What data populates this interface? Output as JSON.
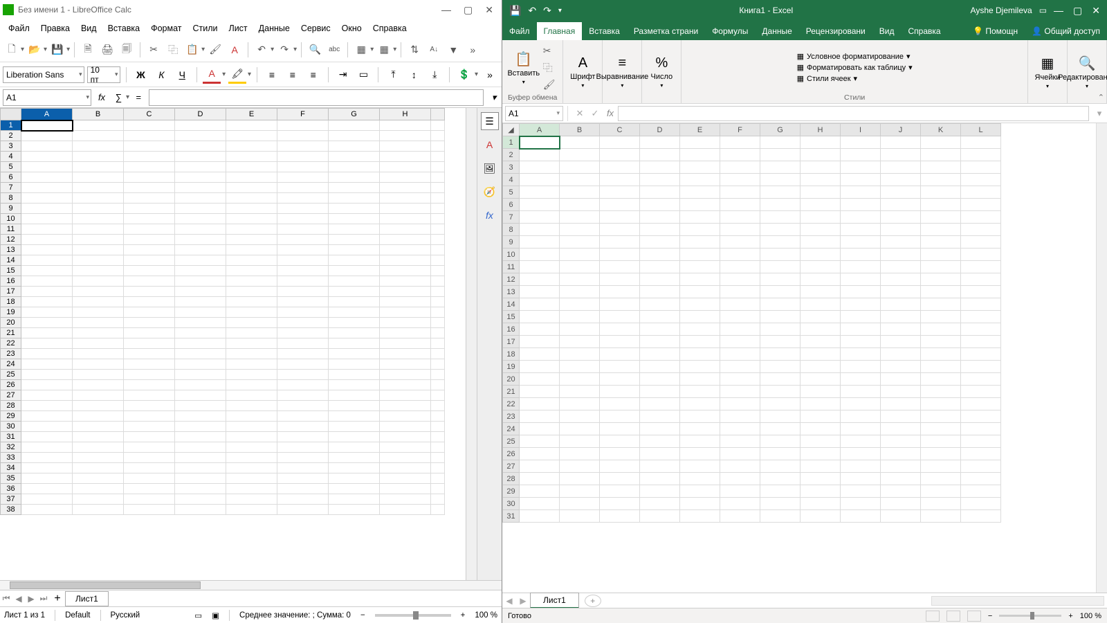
{
  "lo": {
    "title": "Без имени 1 - LibreOffice Calc",
    "menu": [
      "Файл",
      "Правка",
      "Вид",
      "Вставка",
      "Формат",
      "Стили",
      "Лист",
      "Данные",
      "Сервис",
      "Окно",
      "Справка"
    ],
    "fontName": "Liberation Sans",
    "fontSize": "10 пт",
    "cellRef": "A1",
    "tabName": "Лист1",
    "cols": [
      "A",
      "B",
      "C",
      "D",
      "E",
      "F",
      "G",
      "H"
    ],
    "rows": 38,
    "activeCell": "A1",
    "status": {
      "sheet": "Лист 1 из 1",
      "style": "Default",
      "lang": "Русский",
      "calc": "Среднее значение: ;  Сумма: 0",
      "zoom": "100 %"
    }
  },
  "xl": {
    "docTitle": "Книга1  -  Excel",
    "user": "Ayshe Djemileva",
    "ribbonTabs": [
      "Файл",
      "Главная",
      "Вставка",
      "Разметка страни",
      "Формулы",
      "Данные",
      "Рецензировани",
      "Вид",
      "Справка"
    ],
    "activeTab": "Главная",
    "help": "Помощн",
    "share": "Общий доступ",
    "groups": {
      "clipboard": "Буфер обмена",
      "paste": "Вставить",
      "font": "Шрифт",
      "align": "Выравнивание",
      "number": "Число",
      "styles": "Стили",
      "cells": "Ячейки",
      "editing": "Редактирование"
    },
    "styleItems": {
      "cond": "Условное форматирование",
      "table": "Форматировать как таблицу",
      "cell": "Стили ячеек"
    },
    "nameBox": "A1",
    "cols": [
      "A",
      "B",
      "C",
      "D",
      "E",
      "F",
      "G",
      "H",
      "I",
      "J",
      "K",
      "L"
    ],
    "rows": 31,
    "activeCell": "A1",
    "tabName": "Лист1",
    "status": {
      "ready": "Готово",
      "zoom": "100 %"
    }
  }
}
